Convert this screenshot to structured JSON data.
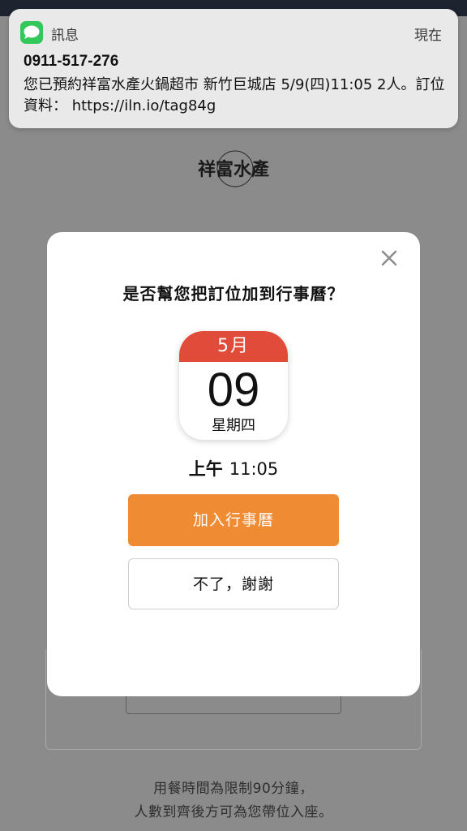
{
  "notification": {
    "app_name": "訊息",
    "time": "現在",
    "sender": "0911-517-276",
    "body": "您已預約祥富水產火鍋超市 新竹巨城店 5/9(四)11:05 2人。訂位資料： https://iln.io/tag84g",
    "icon": "messages-icon",
    "icon_color": "#34c759"
  },
  "background": {
    "logo": "祥富水產",
    "note_line1": "用餐時間為限制90分鐘，",
    "note_line2": "人數到齊後方可為您帶位入座。"
  },
  "dialog": {
    "title": "是否幫您把訂位加到行事曆？",
    "calendar": {
      "month": "5月",
      "day": "09",
      "weekday": "星期四",
      "header_color": "#e14b3a"
    },
    "time_period": "上午",
    "time": "11:05",
    "add_button": "加入行事曆",
    "add_button_color": "#ef8b33",
    "decline_button": "不了，謝謝",
    "close_icon": "close-icon"
  }
}
